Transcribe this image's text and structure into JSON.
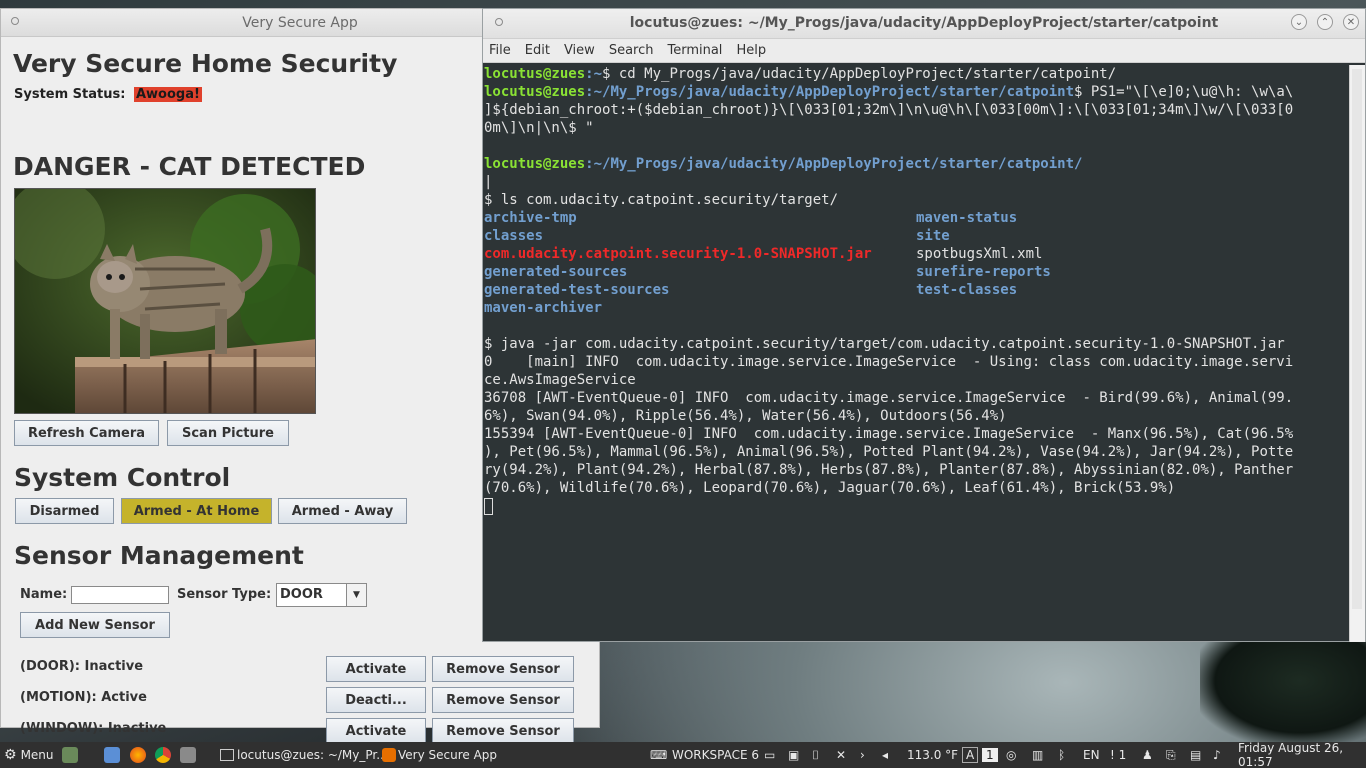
{
  "app": {
    "window_title": "Very Secure App",
    "heading": "Very Secure Home Security",
    "status_label": "System Status:",
    "status_value": "Awooga!",
    "status_color": "#e0412c",
    "danger_heading": "DANGER - CAT DETECTED",
    "refresh_label": "Refresh Camera",
    "scan_label": "Scan Picture",
    "system_control_heading": "System Control",
    "arming": [
      "Disarmed",
      "Armed - At Home",
      "Armed - Away"
    ],
    "active_arming_color": "#c5b32b",
    "sensor_heading": "Sensor Management",
    "name_label": "Name:",
    "type_label": "Sensor Type:",
    "type_value": "DOOR",
    "add_label": "Add New Sensor",
    "sensors": [
      {
        "label": "(DOOR): Inactive",
        "action": "Activate",
        "remove": "Remove Sensor"
      },
      {
        "label": "(MOTION): Active",
        "action": "Deacti...",
        "remove": "Remove Sensor"
      },
      {
        "label": "(WINDOW): Inactive",
        "action": "Activate",
        "remove": "Remove Sensor"
      }
    ]
  },
  "terminal": {
    "window_title": "locutus@zues: ~/My_Progs/java/udacity/AppDeployProject/starter/catpoint",
    "menu": [
      "File",
      "Edit",
      "View",
      "Search",
      "Terminal",
      "Help"
    ],
    "user_host": "locutus@zues",
    "home_path": ":~",
    "cmd1": "$ cd My_Progs/java/udacity/AppDeployProject/starter/catpoint/",
    "project_path": ":~/My_Progs/java/udacity/AppDeployProject/starter/catpoint",
    "ps1_cmd": "$ PS1=\"\\[\\e]0;\\u@\\h: \\w\\a\\",
    "ps1_cont1": "]${debian_chroot:+($debian_chroot)}\\[\\033[01;32m\\]\\n\\u@\\h\\[\\033[00m\\]:\\[\\033[01;34m\\]\\w/\\[\\033[0",
    "ps1_cont2": "0m\\]\\n|\\n\\$ \"",
    "project_path_slash": ":~/My_Progs/java/udacity/AppDeployProject/starter/catpoint/",
    "pipe": "|",
    "ls_cmd": "$ ls com.udacity.catpoint.security/target/",
    "ls_left": [
      {
        "name": "archive-tmp",
        "kind": "dir"
      },
      {
        "name": "classes",
        "kind": "dir"
      },
      {
        "name": "com.udacity.catpoint.security-1.0-SNAPSHOT.jar",
        "kind": "jar"
      },
      {
        "name": "generated-sources",
        "kind": "dir"
      },
      {
        "name": "generated-test-sources",
        "kind": "dir"
      },
      {
        "name": "maven-archiver",
        "kind": "dir"
      }
    ],
    "ls_right": [
      {
        "name": "maven-status",
        "kind": "dir"
      },
      {
        "name": "site",
        "kind": "dir"
      },
      {
        "name": "spotbugsXml.xml",
        "kind": "file"
      },
      {
        "name": "surefire-reports",
        "kind": "dir"
      },
      {
        "name": "test-classes",
        "kind": "dir"
      }
    ],
    "java_cmd": "$ java -jar com.udacity.catpoint.security/target/com.udacity.catpoint.security-1.0-SNAPSHOT.jar",
    "log": [
      "0    [main] INFO  com.udacity.image.service.ImageService  - Using: class com.udacity.image.servi",
      "ce.AwsImageService",
      "36708 [AWT-EventQueue-0] INFO  com.udacity.image.service.ImageService  - Bird(99.6%), Animal(99.",
      "6%), Swan(94.0%), Ripple(56.4%), Water(56.4%), Outdoors(56.4%)",
      "155394 [AWT-EventQueue-0] INFO  com.udacity.image.service.ImageService  - Manx(96.5%), Cat(96.5%",
      "), Pet(96.5%), Mammal(96.5%), Animal(96.5%), Potted Plant(94.2%), Vase(94.2%), Jar(94.2%), Potte",
      "ry(94.2%), Plant(94.2%), Herbal(87.8%), Herbs(87.8%), Planter(87.8%), Abyssinian(82.0%), Panther",
      "(70.6%), Wildlife(70.6%), Leopard(70.6%), Jaguar(70.6%), Leaf(61.4%), Brick(53.9%)"
    ]
  },
  "taskbar": {
    "menu_label": "Menu",
    "task_terminal": "locutus@zues: ~/My_Pr...",
    "task_app": "Very Secure App",
    "workspace": "WORKSPACE 6",
    "temperature": "113.0 °F",
    "kb_a": "A",
    "kb_1": "1",
    "lang": "EN",
    "notif": "! 1",
    "clock": "Friday August 26, 01:57"
  }
}
